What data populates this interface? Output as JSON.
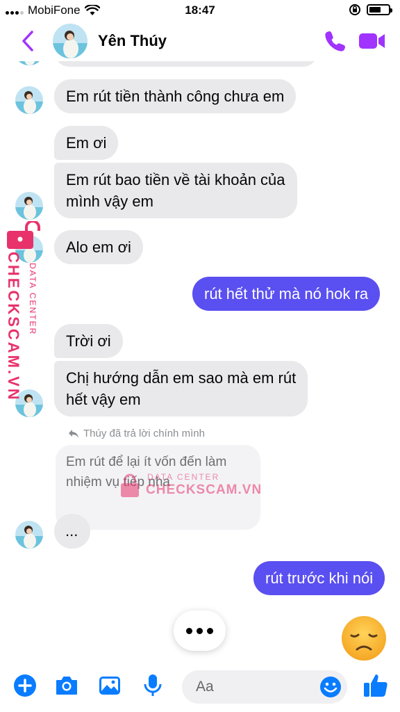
{
  "status_bar": {
    "carrier": "MobiFone",
    "time": "18:47",
    "signal_bars_on": 3,
    "battery_level": 0.6
  },
  "header": {
    "contact_name": "Yên Thúy",
    "back_icon": "chevron-left-icon",
    "call_icon": "phone-icon",
    "video_icon": "video-camera-icon"
  },
  "messages": [
    {
      "from": "contact",
      "text": "Em rút tiền thành công chưa em"
    },
    {
      "from": "contact",
      "text": "Em ơi"
    },
    {
      "from": "contact",
      "text": "Em rút bao tiền về tài khoản của",
      "text_line2": "mình vậy em"
    },
    {
      "from": "contact",
      "text": "Alo em ơi"
    },
    {
      "from": "me",
      "text": "rút hết thử mà nó hok ra"
    },
    {
      "from": "contact",
      "text": "Trời ơi"
    },
    {
      "from": "contact",
      "text": "Chị hướng dẫn em sao mà em rút",
      "text_line2": "hết vậy em"
    },
    {
      "from": "contact",
      "reply_label": "Thúy đã trả lời chính mình",
      "quoted": "Em rút để lại ít vốn đến làm nhiệm vụ tiếp nha",
      "text": "..."
    },
    {
      "from": "me",
      "text": "rút trước khi nói"
    }
  ],
  "watermark": {
    "brand": "CHECKSCAM.VN",
    "tagline": "DATA CENTER"
  },
  "composer": {
    "placeholder": "Aa"
  },
  "colors": {
    "accent": "#a033ff",
    "outgoing_bubble": "#5a4ff0",
    "incoming_bubble": "#e9e9eb",
    "bottom_icons": "#0a7cff",
    "watermark": "#e8326b"
  }
}
